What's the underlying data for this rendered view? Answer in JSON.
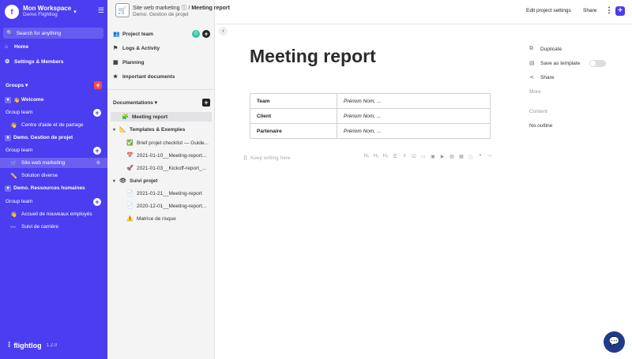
{
  "workspace": {
    "logo": "f",
    "title": "Mon Workspace",
    "subtitle": "Demo Flightlog",
    "chevron": "▾",
    "menu_icon": "☰"
  },
  "sidebar": {
    "search": "Search for anything",
    "home": "Home",
    "settings": "Settings & Members",
    "groups_label": "Groups",
    "sections": [
      {
        "name": "Welcome",
        "emoji": "👋",
        "group": "Group team",
        "pages": [
          {
            "emoji": "👋",
            "label": "Centre d'aide et de partage"
          }
        ]
      },
      {
        "name": "Demo. Gestion de projet",
        "group": "Group team",
        "pages": [
          {
            "emoji": "🛒",
            "label": "Site web marketing"
          },
          {
            "emoji": "✏️",
            "label": "Solution diverse"
          }
        ]
      },
      {
        "name": "Demo. Ressources humaines",
        "group": "Group team",
        "pages": [
          {
            "emoji": "👋",
            "label": "Accueil de nouveaux employés"
          },
          {
            "emoji": "〰",
            "label": "Suivi de carrière"
          }
        ]
      }
    ],
    "brand": "flightlog",
    "version": "1.2.0"
  },
  "project_nav": {
    "team": "Project team",
    "team_count": "0",
    "logs": "Logs & Activity",
    "planning": "Planning",
    "docs": "Important documents"
  },
  "documentation": {
    "title": "Documentations",
    "items": [
      {
        "emoji": "🧩",
        "label": "Meeting report"
      },
      {
        "emoji": "📐",
        "label": "Templates & Exemples"
      },
      {
        "emoji": "✅",
        "label": "Brief projet checklist — Guide..."
      },
      {
        "emoji": "📅",
        "label": "2021-01-10__Meeting-report..."
      },
      {
        "emoji": "🚀",
        "label": "2021-01-03__Kickoff-report_..."
      },
      {
        "emoji": "👁",
        "label": "Suivi projet"
      },
      {
        "emoji": "📄",
        "label": "2021-01-21__Meeting-report"
      },
      {
        "emoji": "📄",
        "label": "2020-12-01__Meeting-report..."
      },
      {
        "emoji": "⚠️",
        "label": "Matrice de risque"
      }
    ]
  },
  "topbar": {
    "project": "Site web marketing",
    "separator": "/",
    "page": "Meeting report",
    "subtitle": "Demo. Gestion de projet",
    "edit": "Edit project settings",
    "share": "Share"
  },
  "document": {
    "title": "Meeting report",
    "rows": [
      {
        "k": "Team",
        "v": "Prénom Nom, ..."
      },
      {
        "k": "Client",
        "v": "Prénom Nom, ..."
      },
      {
        "k": "Partenaire",
        "v": "Prénom Nom, ..."
      }
    ],
    "placeholder": "Keep writing here"
  },
  "right_panel": {
    "duplicate": "Duplicate",
    "save_template": "Save as template",
    "share": "Share",
    "more": "More",
    "content_label": "Content",
    "outline": "No outline"
  }
}
